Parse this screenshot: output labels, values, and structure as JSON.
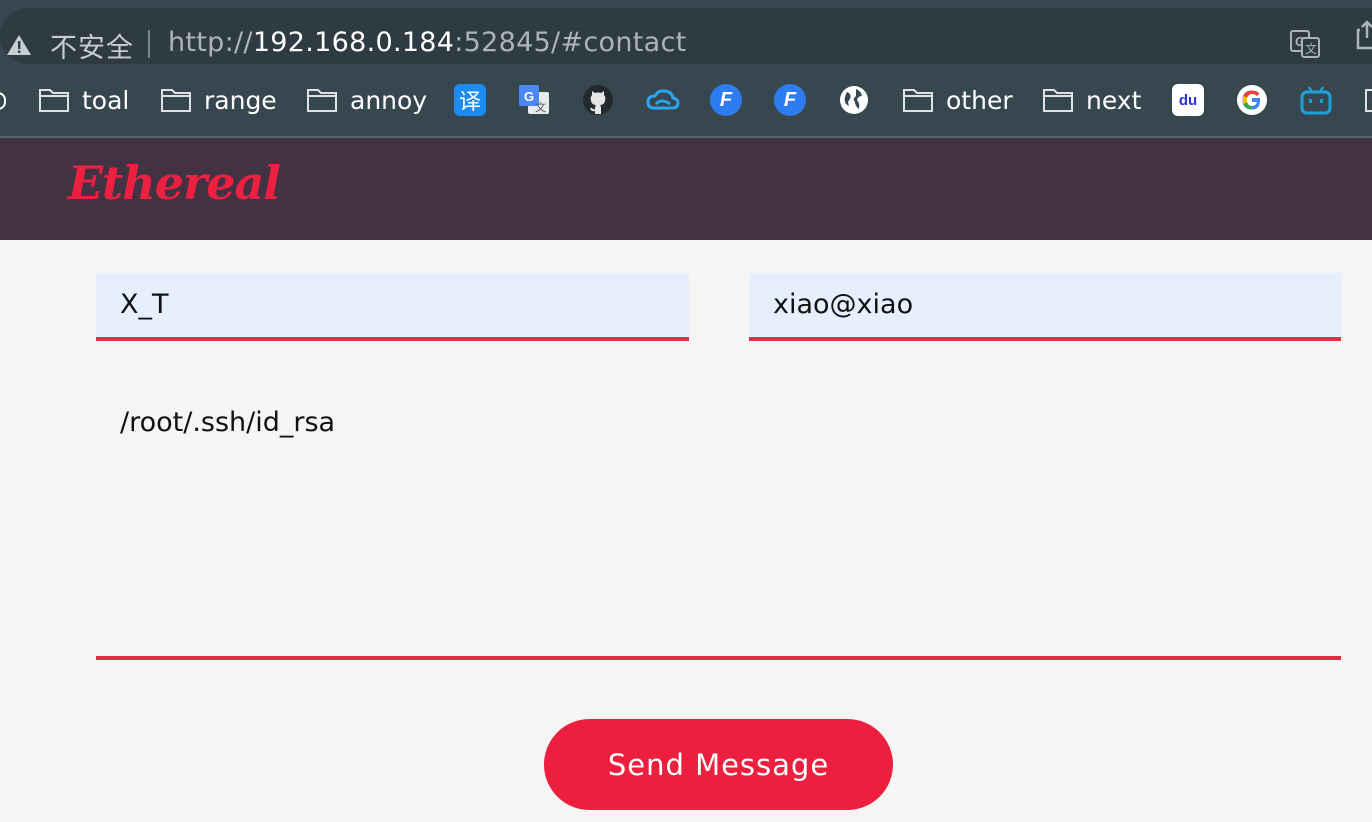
{
  "browser": {
    "insecure_label": "不安全",
    "url": {
      "scheme": "http://",
      "host": "192.168.0.184",
      "rest": ":52845/#contact"
    },
    "bookmarks": [
      {
        "type": "folder",
        "label": "toal"
      },
      {
        "type": "folder",
        "label": "range"
      },
      {
        "type": "folder",
        "label": "annoy"
      },
      {
        "type": "app",
        "icon": "translate-cn-icon",
        "glyph": "译"
      },
      {
        "type": "app",
        "icon": "google-translate-icon",
        "glyph": "G"
      },
      {
        "type": "app",
        "icon": "github-icon"
      },
      {
        "type": "app",
        "icon": "cloud-icon"
      },
      {
        "type": "app",
        "icon": "f-app-icon",
        "glyph": "F"
      },
      {
        "type": "app",
        "icon": "f-app-icon",
        "glyph": "F"
      },
      {
        "type": "app",
        "icon": "globe-icon"
      },
      {
        "type": "folder",
        "label": "other"
      },
      {
        "type": "folder",
        "label": "next"
      },
      {
        "type": "app",
        "icon": "baidu-icon",
        "glyph": "du"
      },
      {
        "type": "app",
        "icon": "google-icon",
        "glyph": "G"
      },
      {
        "type": "app",
        "icon": "bilibili-icon"
      }
    ]
  },
  "site": {
    "logo": "Ethereal"
  },
  "form": {
    "name_value": "X_T",
    "email_value": "xiao@xiao",
    "message_value": "/root/.ssh/id_rsa",
    "submit_label": "Send Message"
  },
  "colors": {
    "header_bg": "#433244",
    "accent": "#ec1f3e",
    "input_bg": "#e6effd",
    "chrome_bg": "#37474f"
  }
}
